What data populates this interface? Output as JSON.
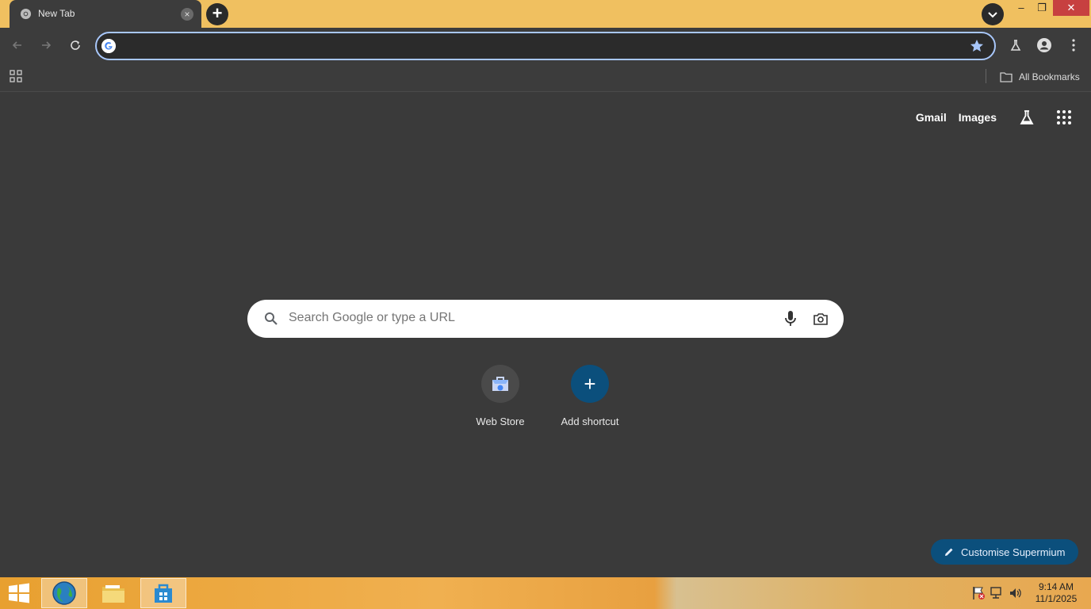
{
  "browser": {
    "tab": {
      "title": "New Tab",
      "close_label": "×"
    },
    "new_tab_label": "+",
    "window_controls": {
      "minimize": "–",
      "maximize": "❐",
      "close": "✕"
    },
    "omnibox": {
      "value": "",
      "placeholder": ""
    },
    "bookmarks": {
      "all_bookmarks_label": "All Bookmarks"
    }
  },
  "ntp": {
    "links": {
      "gmail": "Gmail",
      "images": "Images"
    },
    "search": {
      "placeholder": "Search Google or type a URL"
    },
    "shortcuts": [
      {
        "label": "Web Store"
      },
      {
        "label": "Add shortcut",
        "icon_glyph": "+"
      }
    ],
    "customise_label": "Customise Supermium"
  },
  "taskbar": {
    "clock": {
      "time": "9:14 AM",
      "date": "11/1/2025"
    }
  },
  "icons": {
    "tab_favicon": "chrome-icon",
    "back": "back-arrow-icon",
    "forward": "forward-arrow-icon",
    "reload": "reload-icon",
    "bookmark_star": "star-icon",
    "labs": "labs-flask-icon",
    "profile": "profile-icon",
    "menu": "kebab-menu-icon",
    "apps": "apps-grid-icon",
    "folder": "folder-icon",
    "search": "search-icon",
    "mic": "microphone-icon",
    "camera": "camera-icon",
    "pencil": "pencil-icon"
  },
  "colors": {
    "accent": "#a8c7fa",
    "customise_bg": "#0b4f7c",
    "titlebar": "#f0c060",
    "background": "#3a3a3a"
  }
}
